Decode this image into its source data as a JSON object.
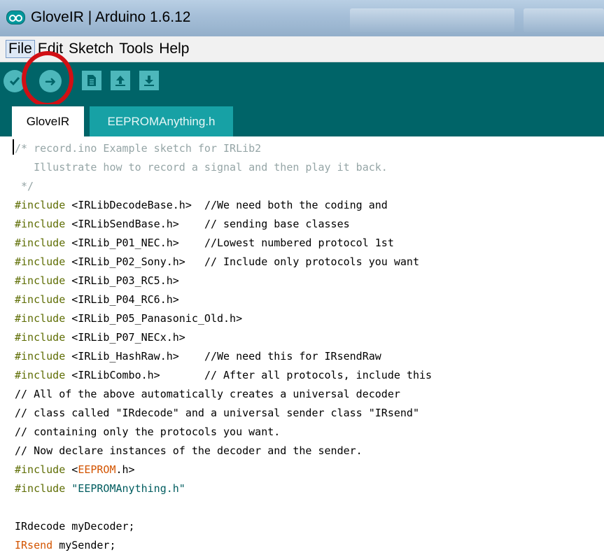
{
  "window": {
    "title": "GloveIR | Arduino 1.6.12"
  },
  "menu": [
    "File",
    "Edit",
    "Sketch",
    "Tools",
    "Help"
  ],
  "toolbar": {
    "buttons": [
      "verify-icon",
      "upload-icon",
      "new-icon",
      "open-icon",
      "save-icon"
    ],
    "upload_arrow": "➜"
  },
  "tabs": [
    {
      "label": "GloveIR",
      "active": true
    },
    {
      "label": "EEPROMAnything.h",
      "active": false
    }
  ],
  "editor": {
    "lines": [
      [
        {
          "t": "/* record.ino Example sketch for IRLib2",
          "c": "comment"
        }
      ],
      [
        {
          "t": "   Illustrate how to record a signal and then play it back.",
          "c": "comment"
        }
      ],
      [
        {
          "t": " */",
          "c": "comment"
        }
      ],
      [
        {
          "t": "#include",
          "c": "pre"
        },
        {
          "t": " <IRLibDecodeBase.h>  ",
          "c": "plain"
        },
        {
          "t": "//We need both the coding and",
          "c": "plain"
        }
      ],
      [
        {
          "t": "#include",
          "c": "pre"
        },
        {
          "t": " <IRLibSendBase.h>    ",
          "c": "plain"
        },
        {
          "t": "// sending base classes",
          "c": "plain"
        }
      ],
      [
        {
          "t": "#include",
          "c": "pre"
        },
        {
          "t": " <IRLib_P01_NEC.h>    ",
          "c": "plain"
        },
        {
          "t": "//Lowest numbered protocol 1st",
          "c": "plain"
        }
      ],
      [
        {
          "t": "#include",
          "c": "pre"
        },
        {
          "t": " <IRLib_P02_Sony.h>   ",
          "c": "plain"
        },
        {
          "t": "// Include only protocols you want",
          "c": "plain"
        }
      ],
      [
        {
          "t": "#include",
          "c": "pre"
        },
        {
          "t": " <IRLib_P03_RC5.h>",
          "c": "plain"
        }
      ],
      [
        {
          "t": "#include",
          "c": "pre"
        },
        {
          "t": " <IRLib_P04_RC6.h>",
          "c": "plain"
        }
      ],
      [
        {
          "t": "#include",
          "c": "pre"
        },
        {
          "t": " <IRLib_P05_Panasonic_Old.h>",
          "c": "plain"
        }
      ],
      [
        {
          "t": "#include",
          "c": "pre"
        },
        {
          "t": " <IRLib_P07_NECx.h>",
          "c": "plain"
        }
      ],
      [
        {
          "t": "#include",
          "c": "pre"
        },
        {
          "t": " <IRLib_HashRaw.h>    ",
          "c": "plain"
        },
        {
          "t": "//We need this for IRsendRaw",
          "c": "plain"
        }
      ],
      [
        {
          "t": "#include",
          "c": "pre"
        },
        {
          "t": " <IRLibCombo.h>       ",
          "c": "plain"
        },
        {
          "t": "// After all protocols, include this",
          "c": "plain"
        }
      ],
      [
        {
          "t": "// All of the above automatically creates a universal decoder",
          "c": "plain"
        }
      ],
      [
        {
          "t": "// class called \"IRdecode\" and a universal sender class \"IRsend\"",
          "c": "plain"
        }
      ],
      [
        {
          "t": "// containing only the protocols you want.",
          "c": "plain"
        }
      ],
      [
        {
          "t": "// Now declare instances of the decoder and the sender.",
          "c": "plain"
        }
      ],
      [
        {
          "t": "#include",
          "c": "pre"
        },
        {
          "t": " <",
          "c": "plain"
        },
        {
          "t": "EEPROM",
          "c": "kw"
        },
        {
          "t": ".h>",
          "c": "plain"
        }
      ],
      [
        {
          "t": "#include",
          "c": "pre"
        },
        {
          "t": " ",
          "c": "plain"
        },
        {
          "t": "\"EEPROMAnything.h\"",
          "c": "str"
        }
      ],
      [],
      [
        {
          "t": "IRdecode myDecoder;",
          "c": "plain"
        }
      ],
      [
        {
          "t": "IRsend",
          "c": "kw"
        },
        {
          "t": " mySender;",
          "c": "plain"
        }
      ]
    ]
  },
  "colors": {
    "toolbar": "#006468",
    "button": "#4db7bb",
    "highlight_ring": "#d10f14",
    "comment": "#95a5a6",
    "preprocessor": "#5e6d03",
    "keyword": "#d35400",
    "string": "#005c5f"
  }
}
